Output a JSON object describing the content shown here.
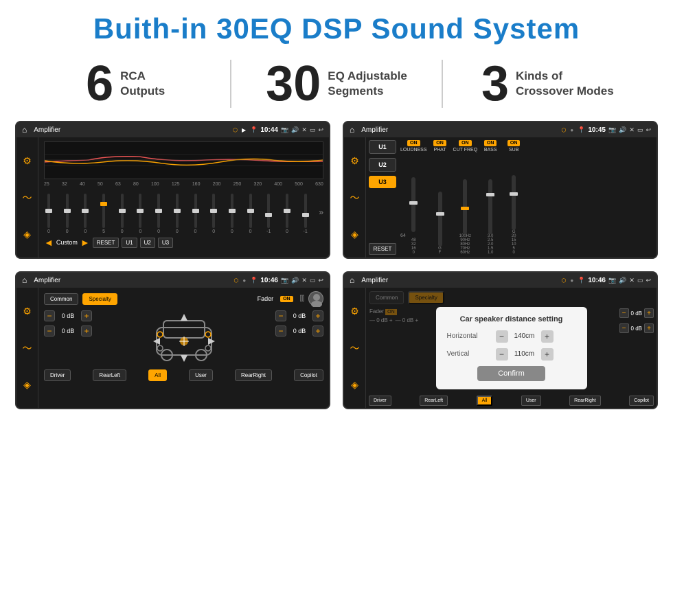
{
  "page": {
    "title": "Buith-in 30EQ DSP Sound System",
    "title_color": "#1a7dc9"
  },
  "stats": [
    {
      "number": "6",
      "text_line1": "RCA",
      "text_line2": "Outputs"
    },
    {
      "number": "30",
      "text_line1": "EQ Adjustable",
      "text_line2": "Segments"
    },
    {
      "number": "3",
      "text_line1": "Kinds of",
      "text_line2": "Crossover Modes"
    }
  ],
  "screens": [
    {
      "id": "eq-screen",
      "topbar": {
        "title": "Amplifier",
        "time": "10:44"
      },
      "type": "eq"
    },
    {
      "id": "crossover-screen",
      "topbar": {
        "title": "Amplifier",
        "time": "10:45"
      },
      "type": "crossover"
    },
    {
      "id": "fader-screen",
      "topbar": {
        "title": "Amplifier",
        "time": "10:46"
      },
      "type": "fader"
    },
    {
      "id": "dialog-screen",
      "topbar": {
        "title": "Amplifier",
        "time": "10:46"
      },
      "type": "dialog",
      "dialog": {
        "title": "Car speaker distance setting",
        "horizontal_label": "Horizontal",
        "horizontal_value": "140cm",
        "vertical_label": "Vertical",
        "vertical_value": "110cm",
        "confirm_label": "Confirm"
      }
    }
  ],
  "eq": {
    "frequencies": [
      "25",
      "32",
      "40",
      "50",
      "63",
      "80",
      "100",
      "125",
      "160",
      "200",
      "250",
      "320",
      "400",
      "500",
      "630"
    ],
    "values": [
      "0",
      "0",
      "0",
      "5",
      "0",
      "0",
      "0",
      "0",
      "0",
      "0",
      "0",
      "0",
      "-1",
      "0",
      "-1"
    ],
    "slider_positions": [
      50,
      50,
      50,
      35,
      50,
      50,
      50,
      50,
      50,
      50,
      50,
      50,
      60,
      50,
      60
    ],
    "bottom_buttons": [
      "Custom",
      "RESET",
      "U1",
      "U2",
      "U3"
    ]
  },
  "crossover": {
    "u_buttons": [
      "U1",
      "U2",
      "U3"
    ],
    "channels": [
      {
        "label": "LOUDNESS",
        "on": true
      },
      {
        "label": "PHAT",
        "on": true
      },
      {
        "label": "CUT FREQ",
        "on": true
      },
      {
        "label": "BASS",
        "on": true
      },
      {
        "label": "SUB",
        "on": true
      }
    ],
    "reset_label": "RESET"
  },
  "fader": {
    "modes": [
      "Common",
      "Specialty"
    ],
    "fader_label": "Fader",
    "on_label": "ON",
    "db_values": [
      "0 dB",
      "0 dB",
      "0 dB",
      "0 dB"
    ],
    "bottom_buttons": [
      "Driver",
      "RearLeft",
      "All",
      "User",
      "RearRight",
      "Copilot"
    ]
  },
  "dialog": {
    "title": "Car speaker distance setting",
    "horizontal_label": "Horizontal",
    "horizontal_value": "140cm",
    "vertical_label": "Vertical",
    "vertical_value": "110cm",
    "confirm_label": "Confirm",
    "db_values": [
      "0 dB",
      "0 dB"
    ],
    "bottom_buttons": [
      "Driver",
      "RearLeft",
      "All",
      "User",
      "RearRight",
      "Copilot"
    ]
  }
}
